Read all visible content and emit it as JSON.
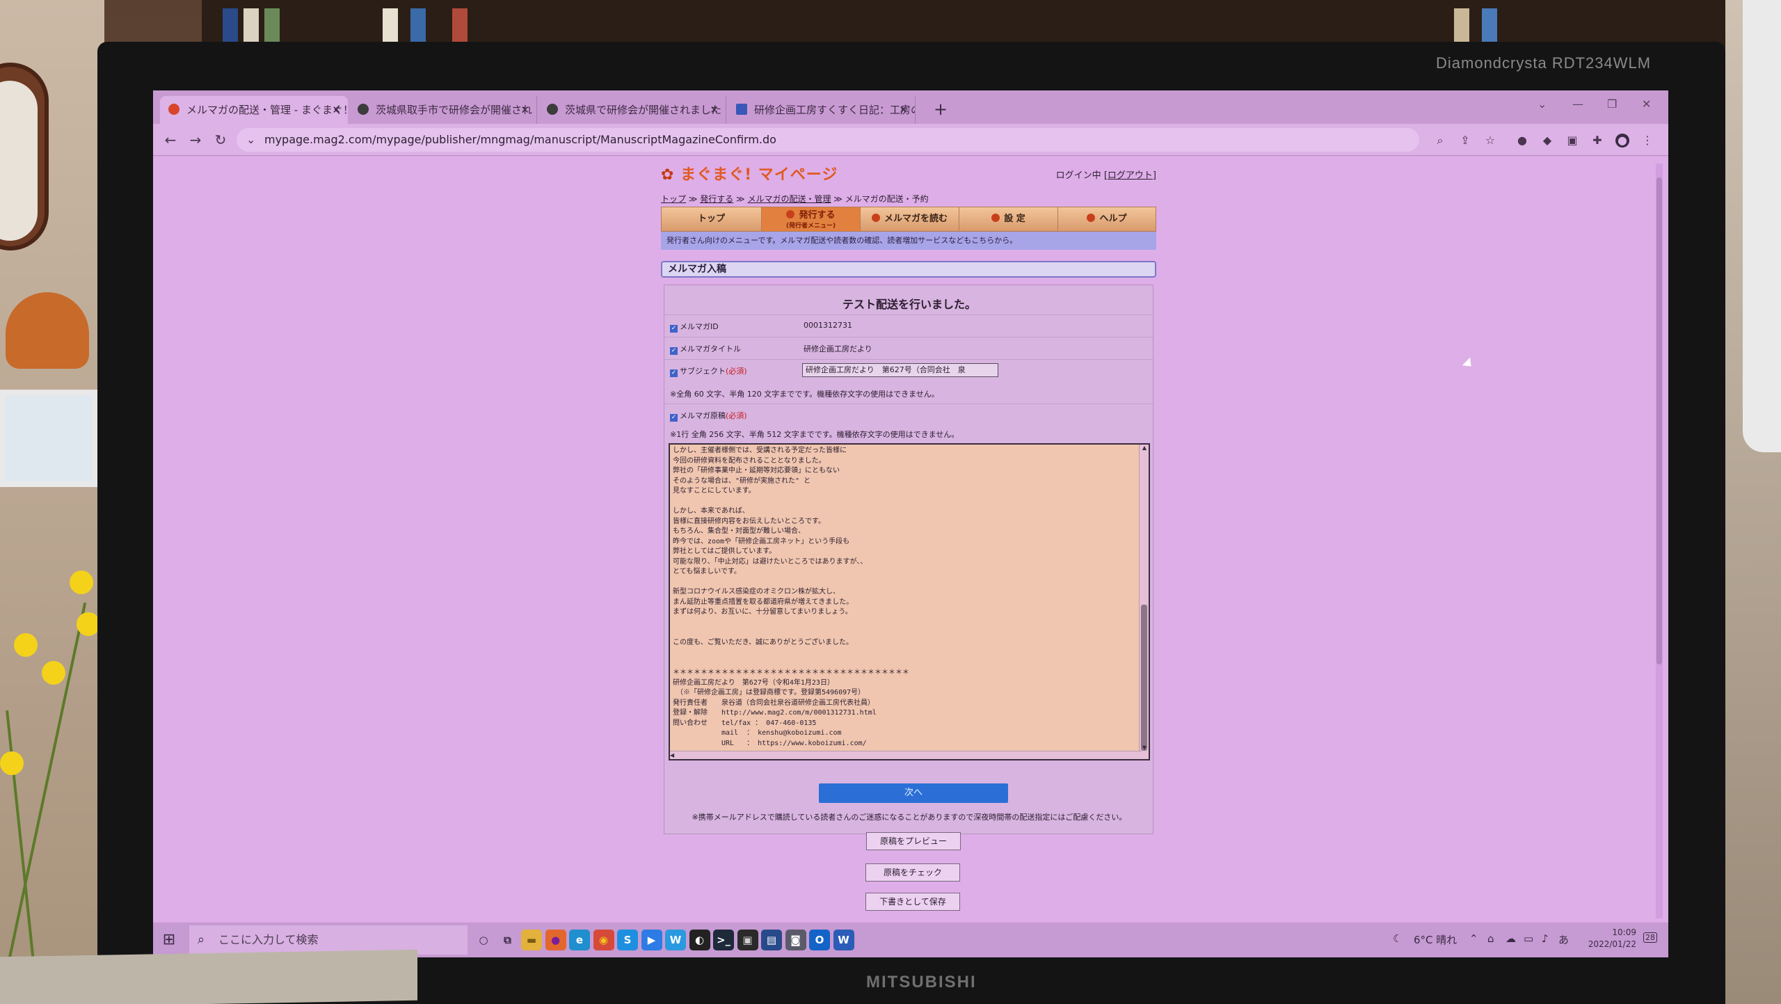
{
  "monitor": {
    "brand": "Diamondcrysta RDT234WLM",
    "maker": "MITSUBISHI"
  },
  "browser": {
    "tabs": [
      {
        "label": "メルマガの配送・管理 - まぐまぐ！マイ",
        "favicon": "#d8452b"
      },
      {
        "label": "茨城県取手市で研修会が開催され",
        "favicon": "#3c3c3c"
      },
      {
        "label": "茨城県で研修会が開催されました",
        "favicon": "#3c3c3c"
      },
      {
        "label": "研修企画工房すくすく日記：工房の",
        "favicon": "#3a58b8"
      }
    ],
    "new_tab": "+",
    "url": "mypage.mag2.com/mypage/publisher/mngmag/manuscript/ManuscriptMagazineConfirm.do"
  },
  "site": {
    "logo": "まぐまぐ! マイページ",
    "login_status": "ログイン中",
    "logout_label": "ログアウト",
    "breadcrumb": [
      "トップ",
      "発行する",
      "メルマガの配送・管理",
      "メルマガの配送・予約"
    ],
    "nav": [
      {
        "label": "トップ"
      },
      {
        "label": "発行する",
        "sub": "(発行者メニュー)"
      },
      {
        "label": "メルマガを読む"
      },
      {
        "label": "設 定"
      },
      {
        "label": "ヘルプ"
      }
    ],
    "subbar": "発行者さん向けのメニューです。メルマガ配送や読者数の確認、読者増加サービスなどもこちらから。",
    "section_title": "メルマガ入稿"
  },
  "form": {
    "notice": "テスト配送を行いました。",
    "fields": {
      "id_label": "メルマガID",
      "id_value": "0001312731",
      "title_label": "メルマガタイトル",
      "title_value": "研修企画工房だより",
      "subject_label": "サブジェクト",
      "required": "(必須)",
      "subject_value": "研修企画工房だより　第627号（合同会社　泉",
      "subject_hint": "※全角 60 文字、半角 120 文字までです。機種依存文字の使用はできません。",
      "body_label": "メルマガ原稿",
      "body_hint": "※1行 全角 256 文字、半角 512 文字までです。機種依存文字の使用はできません。"
    },
    "body_text": "しかし、主催者様側では、受講される予定だった皆様に\n今回の研修資料を配布されることとなりました。\n弊社の「研修事業中止・延期等対応要領」にともない\nそのような場合は、\"研修が実施された\" と\n見なすことにしています。\n\nしかし、本来であれば、\n皆様に直接研修内容をお伝えしたいところです。\nもちろん、集合型・対面型が難しい場合、\n昨今では、zoomや「研修企画工房ネット」という手段も\n弊社としてはご提供しています。\n可能な限り、「中止対応」は避けたいところではありますが、、\nとても悩ましいです。\n\n新型コロナウイルス感染症のオミクロン株が拡大し、\nまん延防止等重点措置を取る都道府県が増えてきました。\nまずは何より、お互いに、十分留意してまいりましょう。\n\n\nこの度も、ご覧いただき、誠にありがとうございました。\n\n\n＊＊＊＊＊＊＊＊＊＊＊＊＊＊＊＊＊＊＊＊＊＊＊＊＊＊＊＊＊＊＊＊＊＊\n研修企画工房だより　第627号（令和4年1月23日）\n　（※「研修企画工房」は登録商標です。登録第5496097号）\n発行責任者　　泉谷道（合同会社泉谷道研修企画工房代表社員）\n登録・解除　　http://www.mag2.com/m/0001312731.html\n問い合わせ　　tel/fax ： 047-460-0135\n　　　　　　　mail  ： kenshu@koboizumi.com\n　　　　　　　URL   ： https://www.koboizumi.com/",
    "next_button": "次へ",
    "caution": "※携帯メールアドレスで購読している読者さんのご迷惑になることがありますので深夜時間帯の配送指定にはご配慮ください。",
    "preview_button": "原稿をプレビュー",
    "check_button": "原稿をチェック",
    "save_button": "下書きとして保存"
  },
  "taskbar": {
    "search_placeholder": "ここに入力して検索",
    "weather": "6°C 晴れ",
    "ime": "あ",
    "time": "10:09",
    "date": "2022/01/22",
    "notifications": "28",
    "icons": [
      {
        "name": "cortana-icon",
        "glyph": "○",
        "color": "transparent",
        "fg": "#3a2a44"
      },
      {
        "name": "task-view-icon",
        "glyph": "⧉",
        "color": "transparent",
        "fg": "#3a2a44"
      },
      {
        "name": "explorer-icon",
        "glyph": "▬",
        "color": "#e3b23c",
        "fg": "#7a5a10"
      },
      {
        "name": "firefox-icon",
        "glyph": "●",
        "color": "#e2672c",
        "fg": "#7a1f9a"
      },
      {
        "name": "edge-icon",
        "glyph": "e",
        "color": "#1f8fd0",
        "fg": "#ffffff"
      },
      {
        "name": "chrome-icon",
        "glyph": "◉",
        "color": "#d64a3a",
        "fg": "#f4c41a"
      },
      {
        "name": "skype-icon",
        "glyph": "S",
        "color": "#1d8fe0",
        "fg": "#ffffff"
      },
      {
        "name": "zoom-icon",
        "glyph": "▶",
        "color": "#2d7be4",
        "fg": "#ffffff"
      },
      {
        "name": "app-icon",
        "glyph": "W",
        "color": "#2a9ae0",
        "fg": "#ffffff"
      },
      {
        "name": "media-icon",
        "glyph": "◐",
        "color": "#222222",
        "fg": "#ffffff"
      },
      {
        "name": "terminal-icon",
        "glyph": ">_",
        "color": "#1e2a3a",
        "fg": "#ffffff"
      },
      {
        "name": "editor-icon",
        "glyph": "▣",
        "color": "#2a2a2a",
        "fg": "#d0d0d0"
      },
      {
        "name": "video-icon",
        "glyph": "▤",
        "color": "#284a8a",
        "fg": "#ffffff"
      },
      {
        "name": "camera-icon",
        "glyph": "◙",
        "color": "#5a5a6a",
        "fg": "#ffffff"
      },
      {
        "name": "outlook-icon",
        "glyph": "O",
        "color": "#1464c8",
        "fg": "#ffffff"
      },
      {
        "name": "word-icon",
        "glyph": "W",
        "color": "#2b5cb8",
        "fg": "#ffffff"
      }
    ]
  }
}
